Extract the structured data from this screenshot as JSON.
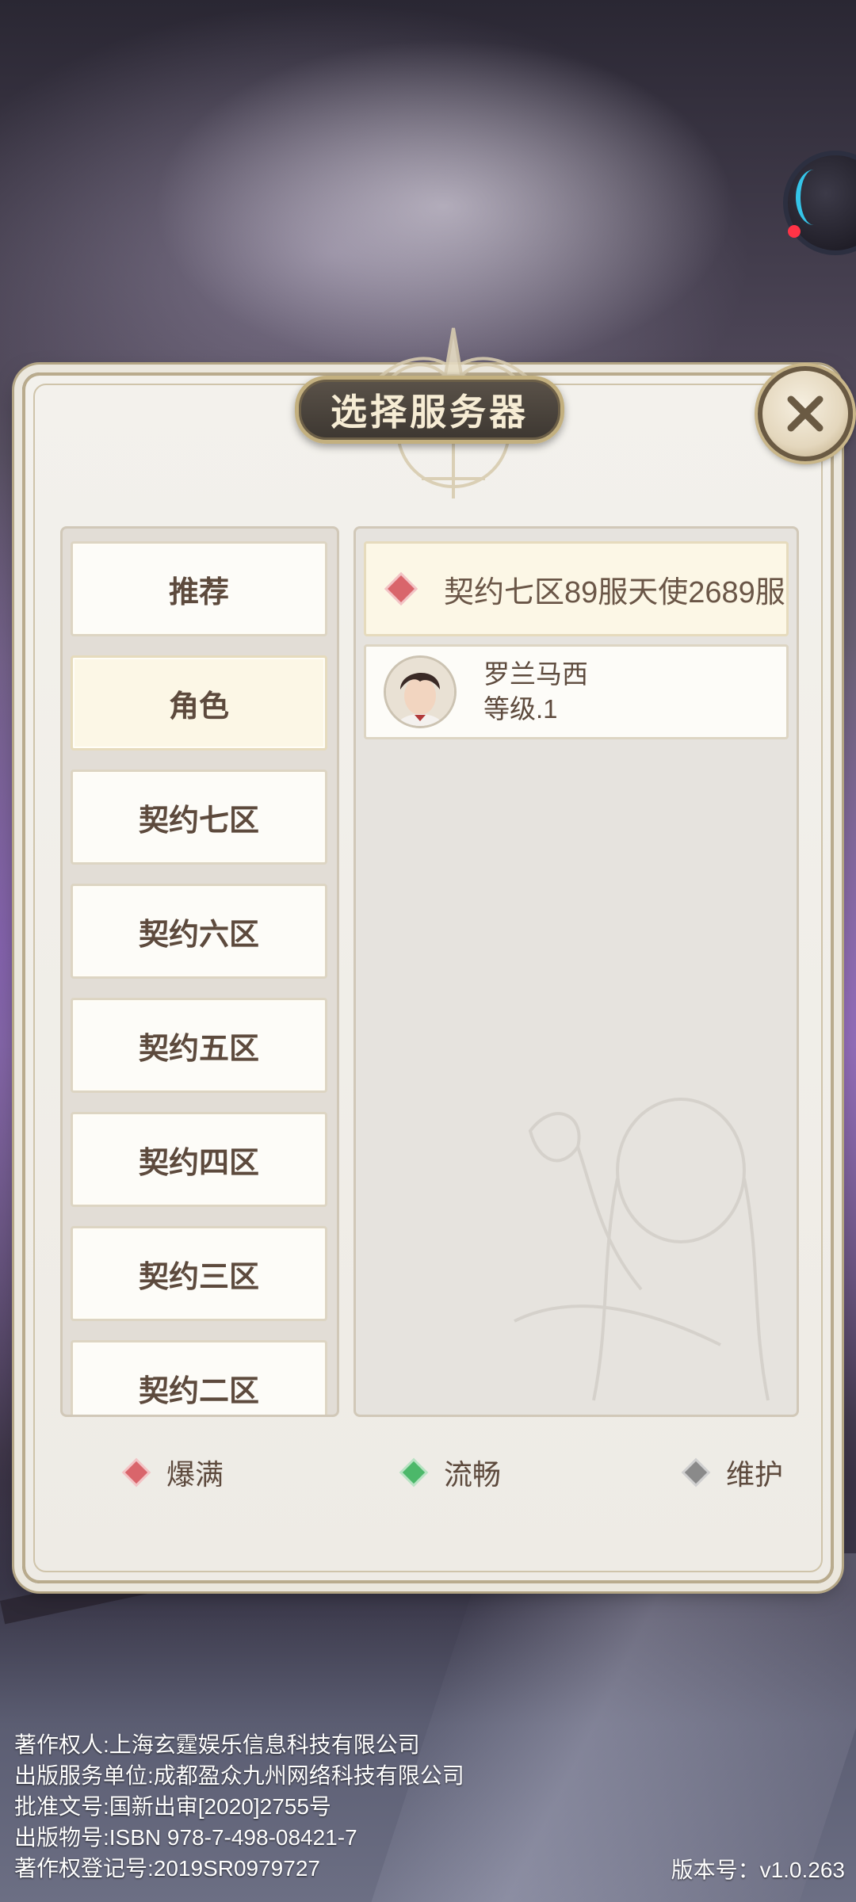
{
  "dialog": {
    "title": "选择服务器"
  },
  "left_menu": {
    "items": [
      {
        "label": "推荐",
        "selected": false
      },
      {
        "label": "角色",
        "selected": true
      },
      {
        "label": "契约七区",
        "selected": false
      },
      {
        "label": "契约六区",
        "selected": false
      },
      {
        "label": "契约五区",
        "selected": false
      },
      {
        "label": "契约四区",
        "selected": false
      },
      {
        "label": "契约三区",
        "selected": false
      },
      {
        "label": "契约二区",
        "selected": false
      }
    ]
  },
  "server": {
    "name": "契约七区89服天使2689服",
    "status_color": "#d9656b"
  },
  "character": {
    "name": "罗兰马西",
    "level": "等级.1"
  },
  "legend": {
    "full": {
      "label": "爆满",
      "color": "#d9656b"
    },
    "smooth": {
      "label": "流畅",
      "color": "#4cb86a"
    },
    "maintenance": {
      "label": "维护",
      "color": "#8a8a8a"
    }
  },
  "footer": {
    "copyright_holder": "著作权人:上海玄霆娱乐信息科技有限公司",
    "publisher": "出版服务单位:成都盈众九州网络科技有限公司",
    "approval": "批准文号:国新出审[2020]2755号",
    "isbn": "出版物号:ISBN 978-7-498-08421-7",
    "registration": "著作权登记号:2019SR0979727",
    "version": "版本号：v1.0.263"
  }
}
